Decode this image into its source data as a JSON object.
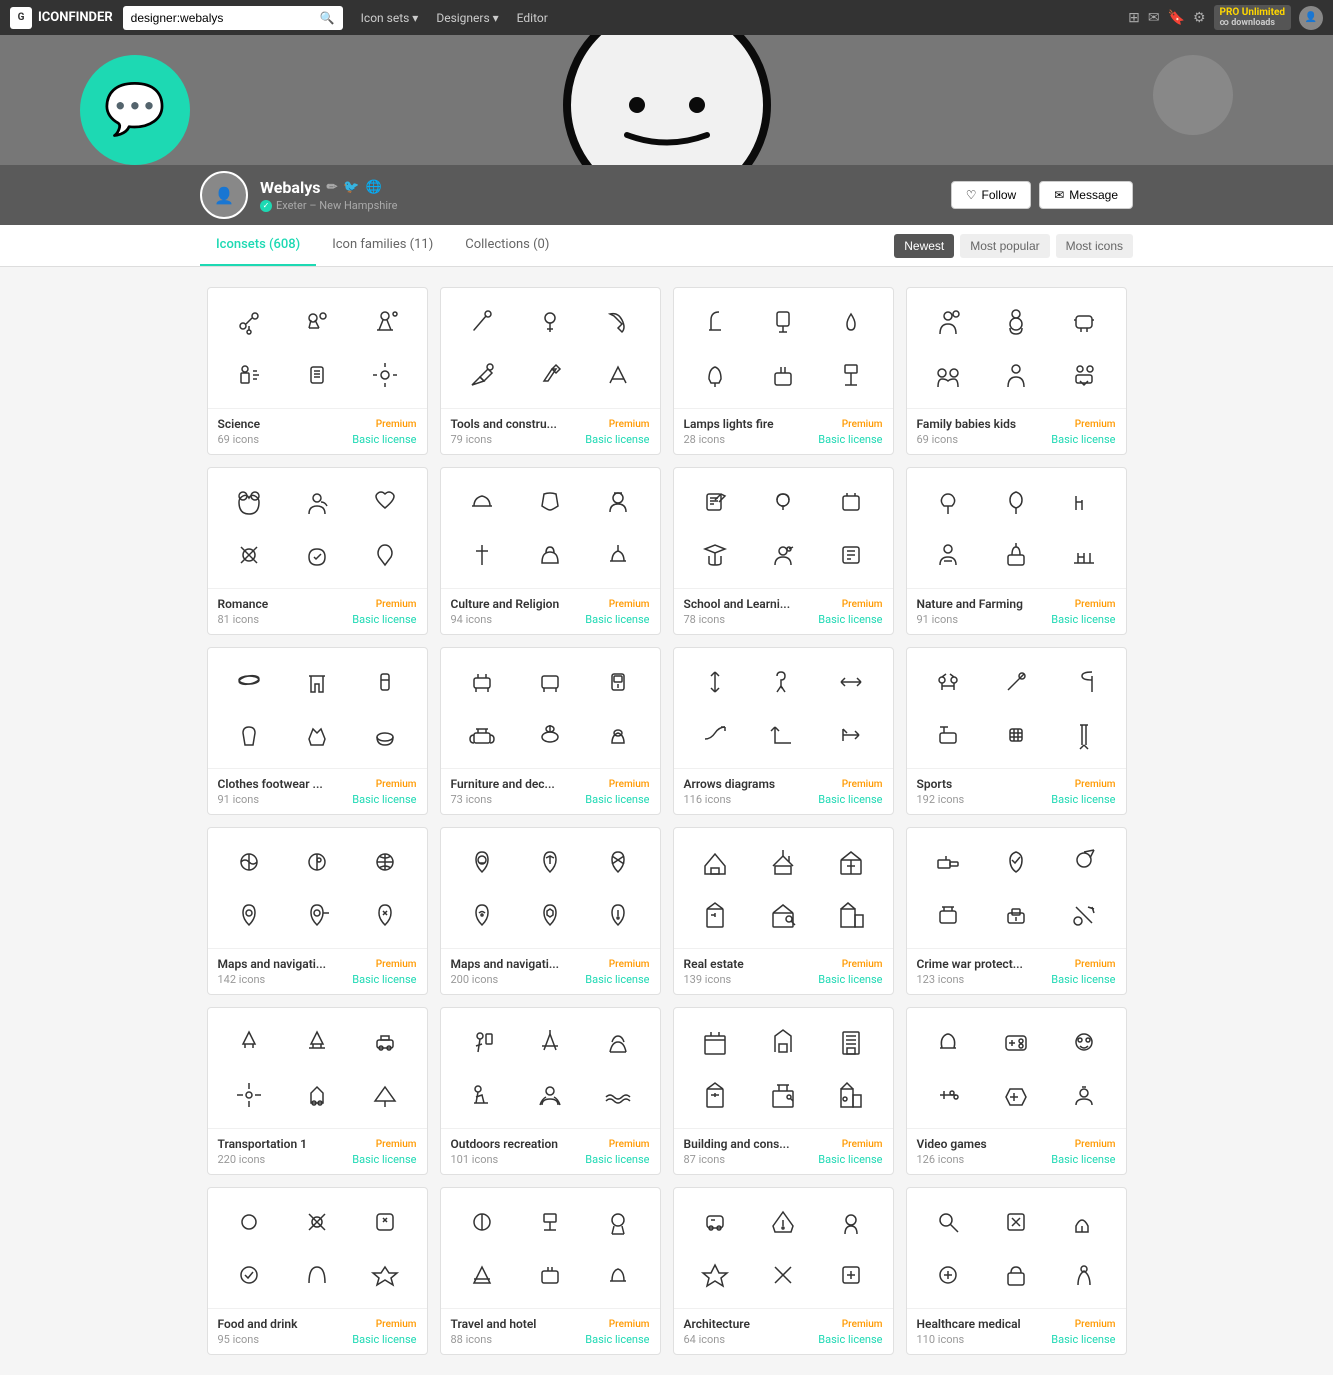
{
  "topnav": {
    "logo_text": "ICONFINDER",
    "search_placeholder": "designer:webalys",
    "search_value": "designer:webalys",
    "links": [
      {
        "label": "Icon sets",
        "has_dropdown": true
      },
      {
        "label": "Designers",
        "has_dropdown": true
      },
      {
        "label": "Editor",
        "has_dropdown": false
      }
    ],
    "pro_label": "PRO Unlimited",
    "pro_sub": "∞ downloads"
  },
  "profile": {
    "username": "Webalys",
    "location": "Exeter – New Hampshire",
    "follow_label": "Follow",
    "message_label": "Message"
  },
  "tabs": {
    "items": [
      {
        "label": "Iconsets (608)",
        "active": true
      },
      {
        "label": "Icon families (11)",
        "active": false
      },
      {
        "label": "Collections (0)",
        "active": false
      }
    ],
    "sort_options": [
      {
        "label": "Newest",
        "active": true
      },
      {
        "label": "Most popular",
        "active": false
      },
      {
        "label": "Most icons",
        "active": false
      }
    ]
  },
  "cards": [
    {
      "title": "Science",
      "count": "69 icons",
      "badge": "Premium",
      "license": "Basic license"
    },
    {
      "title": "Tools and constru...",
      "count": "79 icons",
      "badge": "Premium",
      "license": "Basic license"
    },
    {
      "title": "Lamps lights fire",
      "count": "28 icons",
      "badge": "Premium",
      "license": "Basic license"
    },
    {
      "title": "Family babies kids",
      "count": "69 icons",
      "badge": "Premium",
      "license": "Basic license"
    },
    {
      "title": "Romance",
      "count": "81 icons",
      "badge": "Premium",
      "license": "Basic license"
    },
    {
      "title": "Culture and Religion",
      "count": "94 icons",
      "badge": "Premium",
      "license": "Basic license"
    },
    {
      "title": "School and Learni...",
      "count": "78 icons",
      "badge": "Premium",
      "license": "Basic license"
    },
    {
      "title": "Nature and Farming",
      "count": "91 icons",
      "badge": "Premium",
      "license": "Basic license"
    },
    {
      "title": "Clothes footwear ...",
      "count": "91 icons",
      "badge": "Premium",
      "license": "Basic license"
    },
    {
      "title": "Furniture and dec...",
      "count": "73 icons",
      "badge": "Premium",
      "license": "Basic license"
    },
    {
      "title": "Arrows diagrams",
      "count": "116 icons",
      "badge": "Premium",
      "license": "Basic license"
    },
    {
      "title": "Sports",
      "count": "192 icons",
      "badge": "Premium",
      "license": "Basic license"
    },
    {
      "title": "Maps and navigati...",
      "count": "142 icons",
      "badge": "Premium",
      "license": "Basic license"
    },
    {
      "title": "Maps and navigati...",
      "count": "200 icons",
      "badge": "Premium",
      "license": "Basic license"
    },
    {
      "title": "Real estate",
      "count": "139 icons",
      "badge": "Premium",
      "license": "Basic license"
    },
    {
      "title": "Crime war protect...",
      "count": "123 icons",
      "badge": "Premium",
      "license": "Basic license"
    },
    {
      "title": "Transportation 1",
      "count": "220 icons",
      "badge": "Premium",
      "license": "Basic license"
    },
    {
      "title": "Outdoors recreation",
      "count": "101 icons",
      "badge": "Premium",
      "license": "Basic license"
    },
    {
      "title": "Building and cons...",
      "count": "87 icons",
      "badge": "Premium",
      "license": "Basic license"
    },
    {
      "title": "Video games",
      "count": "126 icons",
      "badge": "Premium",
      "license": "Basic license"
    },
    {
      "title": "...",
      "count": "",
      "badge": "Premium",
      "license": "Basic license"
    },
    {
      "title": "...",
      "count": "",
      "badge": "Premium",
      "license": "Basic license"
    },
    {
      "title": "...",
      "count": "",
      "badge": "Premium",
      "license": "Basic license"
    },
    {
      "title": "...",
      "count": "",
      "badge": "Premium",
      "license": "Basic license"
    }
  ]
}
